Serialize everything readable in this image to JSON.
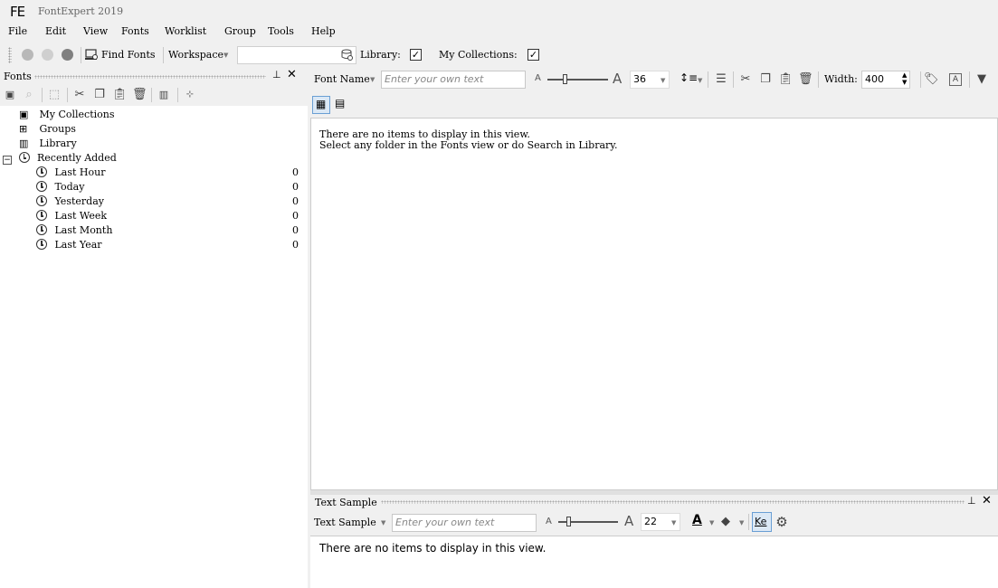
{
  "app": {
    "logo": "FE",
    "title": "FontExpert 2019"
  },
  "menu": [
    "File",
    "Edit",
    "View",
    "Fonts",
    "Worklist",
    "Group",
    "Tools",
    "Help"
  ],
  "toolbar": {
    "find_fonts": "Find Fonts",
    "workspace": "Workspace",
    "library_label": "Library:",
    "my_collections_label": "My Collections:",
    "library_checked": true,
    "my_collections_checked": true
  },
  "left_panel": {
    "title": "Fonts",
    "tree": [
      {
        "label": "My Collections",
        "icon": "user-icon",
        "count": ""
      },
      {
        "label": "Groups",
        "icon": "groups-icon",
        "count": ""
      },
      {
        "label": "Library",
        "icon": "library-icon",
        "count": ""
      },
      {
        "label": "Recently Added",
        "icon": "clock-icon",
        "count": ""
      },
      {
        "label": "Last Hour",
        "icon": "clock-icon",
        "count": "0"
      },
      {
        "label": "Today",
        "icon": "clock-icon",
        "count": "0"
      },
      {
        "label": "Yesterday",
        "icon": "clock-icon",
        "count": "0"
      },
      {
        "label": "Last Week",
        "icon": "clock-icon",
        "count": "0"
      },
      {
        "label": "Last Month",
        "icon": "clock-icon",
        "count": "0"
      },
      {
        "label": "Last Year",
        "icon": "clock-icon",
        "count": "0"
      }
    ]
  },
  "preview_toolbar": {
    "font_name_label": "Font Name",
    "text_placeholder": "Enter your own text",
    "size_value": "36",
    "width_label": "Width:",
    "width_value": "400"
  },
  "main_view": {
    "empty_line1": "There are no items to display in this view.",
    "empty_line2": "Select any folder in the Fonts view or do Search in Library."
  },
  "text_sample": {
    "panel_title": "Text Sample",
    "label": "Text Sample",
    "text_placeholder": "Enter your own text",
    "size_value": "22",
    "kerning_label": "Ke",
    "empty_message": "There are no items to display in this view."
  }
}
